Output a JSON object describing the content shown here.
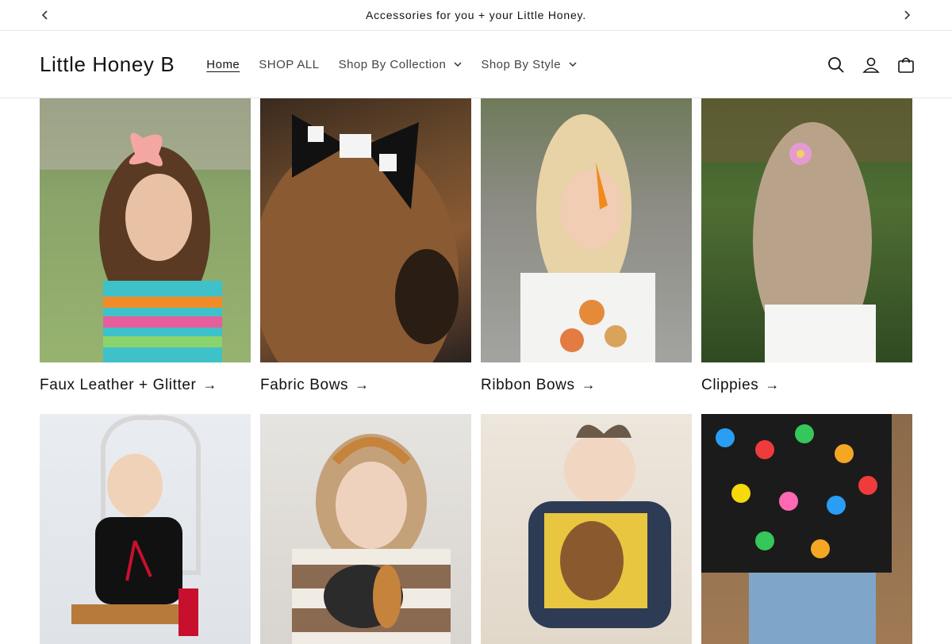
{
  "announcement": {
    "message": "Accessories for you + your Little Honey.",
    "prev_icon": "chevron-left-icon",
    "next_icon": "chevron-right-icon"
  },
  "header": {
    "logo": "Little Honey B",
    "nav": [
      {
        "label": "Home",
        "active": true
      },
      {
        "label": "SHOP ALL",
        "active": false
      },
      {
        "label": "Shop By Collection",
        "active": false,
        "dropdown": true
      },
      {
        "label": "Shop By Style",
        "active": false,
        "dropdown": true
      }
    ],
    "icons": [
      "search-icon",
      "account-icon",
      "cart-icon"
    ]
  },
  "collections": [
    {
      "title": "Faux Leather + Glitter",
      "arrow": "→"
    },
    {
      "title": "Fabric Bows",
      "arrow": "→"
    },
    {
      "title": "Ribbon Bows",
      "arrow": "→"
    },
    {
      "title": "Clippies",
      "arrow": "→"
    },
    {
      "title": "",
      "arrow": ""
    },
    {
      "title": "",
      "arrow": ""
    },
    {
      "title": "",
      "arrow": ""
    },
    {
      "title": "",
      "arrow": ""
    }
  ]
}
